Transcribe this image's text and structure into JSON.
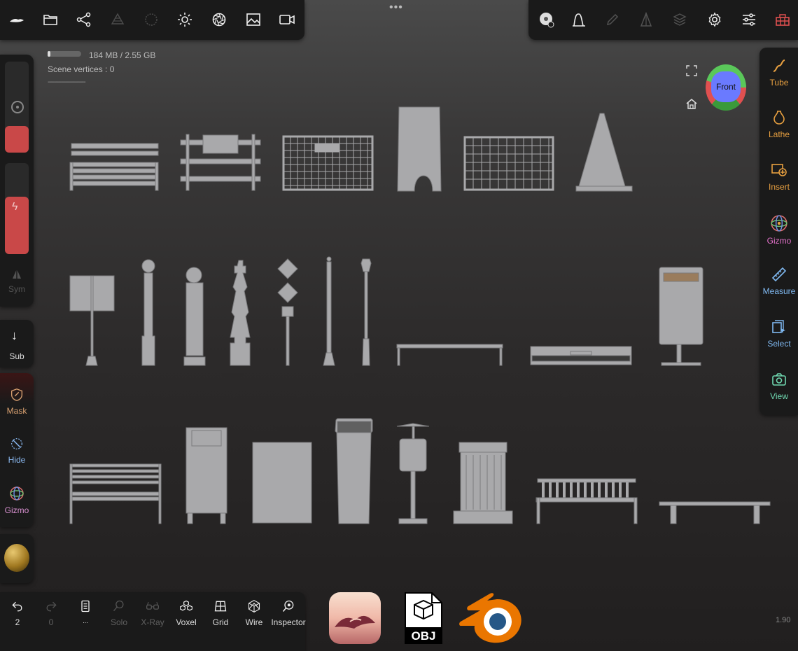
{
  "top_toolbar": {
    "left_icons": [
      "sculpt-logo-icon",
      "folder-icon",
      "share-nodes-icon",
      "layers-stack-icon",
      "globe-icon",
      "light-icon",
      "aperture-icon",
      "image-icon",
      "video-icon"
    ],
    "more_dots": "•••",
    "right_icons": [
      "material-disc-icon",
      "curve-icon",
      "paint-brush-icon",
      "triangle-icon",
      "stack-icon",
      "gear-icon",
      "sliders-icon",
      "toolbox-icon"
    ]
  },
  "hud": {
    "memory": "184 MB / 2.55 GB",
    "scene_vertices": "Scene vertices :  0",
    "divider": "-----------------------"
  },
  "left_bar": {
    "sym_label": "Sym",
    "sub_label": "Sub",
    "mask_label": "Mask",
    "hide_label": "Hide",
    "gizmo_label": "Gizmo"
  },
  "view_cube": {
    "label": "Front"
  },
  "right_bar": {
    "items": [
      {
        "label": "Tube",
        "icon": "tube-icon"
      },
      {
        "label": "Lathe",
        "icon": "lathe-icon"
      },
      {
        "label": "Insert",
        "icon": "insert-icon"
      },
      {
        "label": "Gizmo",
        "icon": "gizmo-icon"
      },
      {
        "label": "Measure",
        "icon": "ruler-icon"
      },
      {
        "label": "Select",
        "icon": "select-icon"
      },
      {
        "label": "View",
        "icon": "camera-icon"
      }
    ],
    "label_colors": [
      "#e8a040",
      "#e8a040",
      "#e8a040",
      "#e070c8",
      "#7fb8f0",
      "#7fb8f0",
      "#6fd8b0"
    ]
  },
  "bottom_toolbar": {
    "undo_count": "2",
    "redo_count": "0",
    "doc_label": "...",
    "items": [
      {
        "label": "Solo",
        "dim": true
      },
      {
        "label": "X-Ray",
        "dim": true
      },
      {
        "label": "Voxel",
        "dim": false
      },
      {
        "label": "Grid",
        "dim": false
      },
      {
        "label": "Wire",
        "dim": false
      },
      {
        "label": "Inspector",
        "dim": false
      }
    ]
  },
  "logos": {
    "obj_text": "OBJ"
  },
  "version": "1.90"
}
